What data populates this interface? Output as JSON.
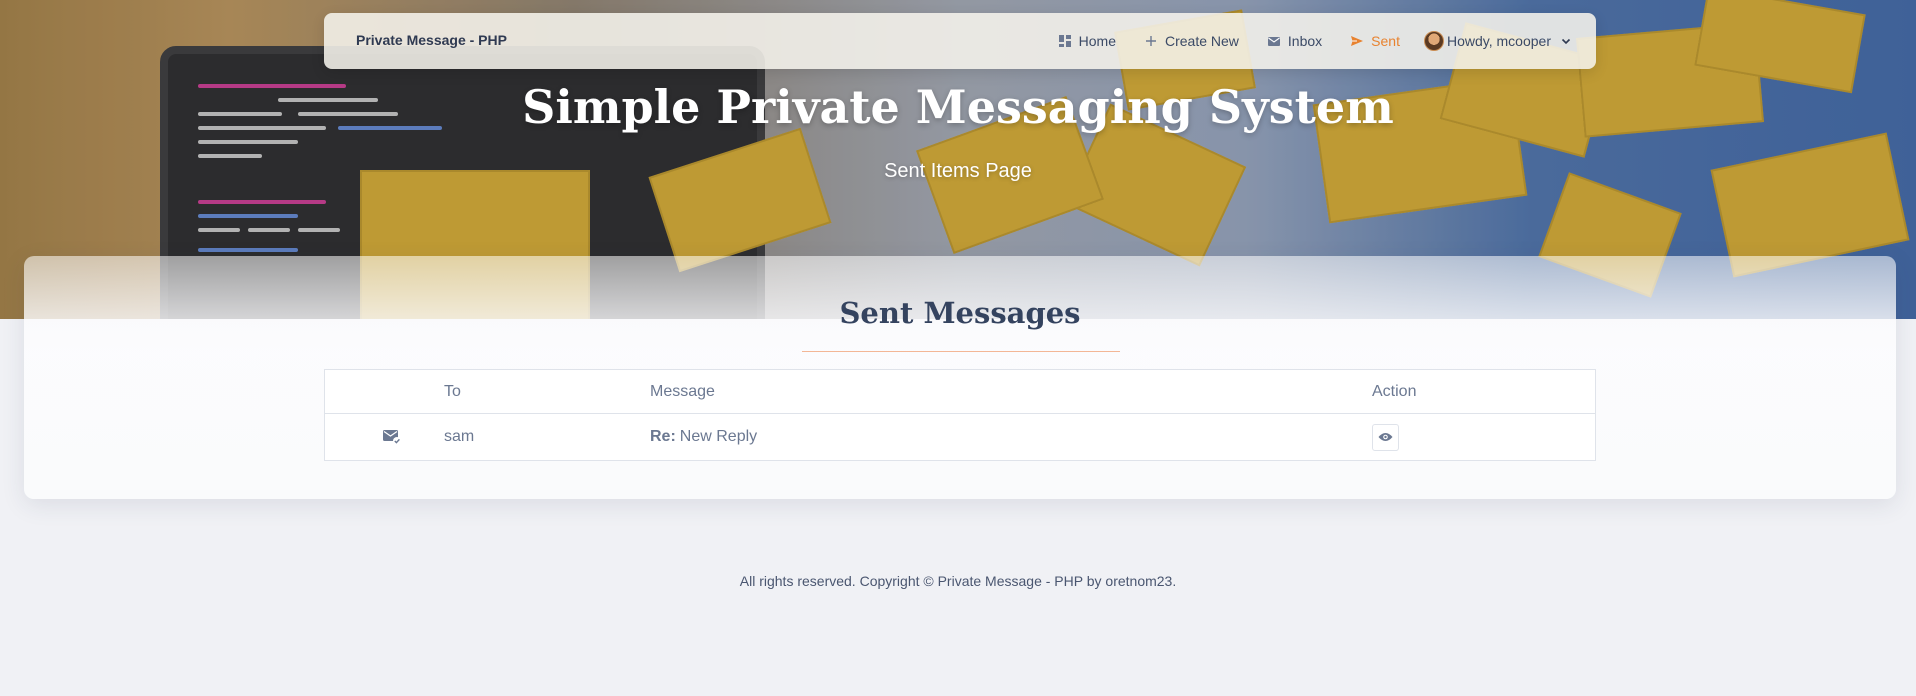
{
  "navbar": {
    "brand": "Private Message - PHP",
    "items": [
      {
        "label": "Home",
        "icon": "dashboard-icon"
      },
      {
        "label": "Create New",
        "icon": "plus-icon"
      },
      {
        "label": "Inbox",
        "icon": "envelope-icon"
      },
      {
        "label": "Sent",
        "icon": "send-icon",
        "active": true
      }
    ],
    "user_label": "Howdy, mcooper"
  },
  "hero": {
    "title": "Simple Private Messaging System",
    "subtitle": "Sent Items Page"
  },
  "content": {
    "title": "Sent Messages",
    "table": {
      "headers": [
        "",
        "To",
        "Message",
        "Action"
      ],
      "rows": [
        {
          "icon": "mail-check-icon",
          "to": "sam",
          "prefix": "Re:",
          "message": "New Reply",
          "action_icon": "eye-icon"
        }
      ]
    }
  },
  "footer": {
    "text": "All rights reserved. Copyright © Private Message - PHP by oretnom23."
  },
  "colors": {
    "accent": "#e8822f",
    "heading": "#34435f",
    "background": "#f0f1f5"
  }
}
